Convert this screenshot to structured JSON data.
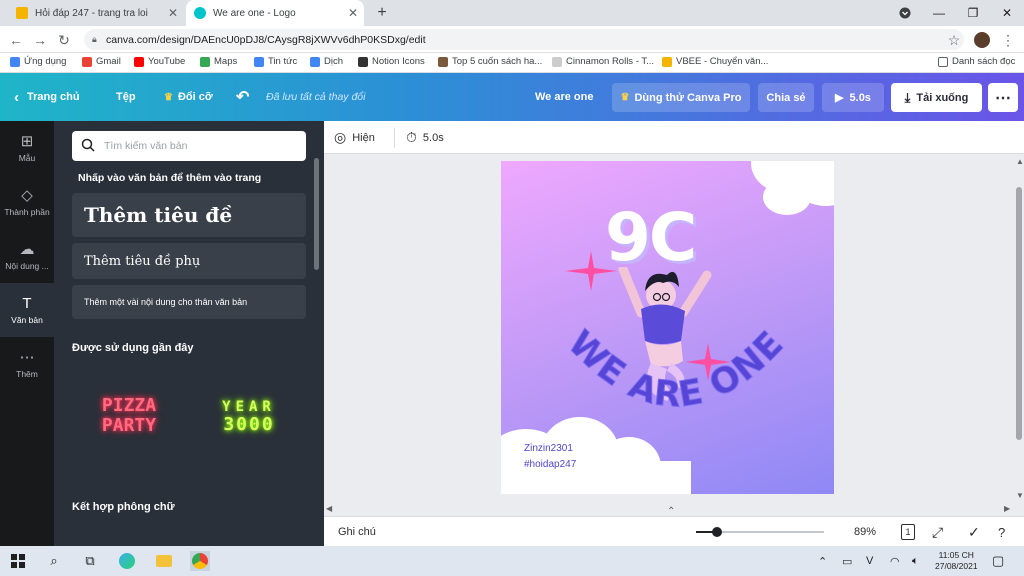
{
  "browser": {
    "tabs": [
      {
        "title": "Hỏi đáp 247 - trang tra loi",
        "active": false,
        "favicon_color": "#f4b400"
      },
      {
        "title": "We are one - Logo",
        "active": true,
        "favicon_color": "#00c4cc"
      }
    ],
    "new_tab_label": "+",
    "url": "canva.com/design/DAEncU0pDJ8/CAysgR8jXWVv6dhP0KSDxg/edit",
    "bookmarks": [
      {
        "label": "Ứng dụng",
        "color": "#4285f4"
      },
      {
        "label": "Gmail",
        "color": "#ea4335"
      },
      {
        "label": "YouTube",
        "color": "#ff0000"
      },
      {
        "label": "Maps",
        "color": "#34a853"
      },
      {
        "label": "Tin tức",
        "color": "#4285f4"
      },
      {
        "label": "Dịch",
        "color": "#4285f4"
      },
      {
        "label": "Notion Icons",
        "color": "#333333"
      },
      {
        "label": "Top 5 cuốn sách ha...",
        "color": "#7a5c3c"
      },
      {
        "label": "Cinnamon Rolls - T...",
        "color": "#cccccc"
      },
      {
        "label": "VBEE - Chuyển văn...",
        "color": "#f4b400"
      }
    ],
    "bookmark_list_label": "Danh sách đọc"
  },
  "canva_header": {
    "home": "Trang chủ",
    "file": "Tệp",
    "resize": "Đổi cỡ",
    "saved_status": "Đã lưu tất cả thay đổi",
    "design_title": "We are one",
    "try_pro": "Dùng thử Canva Pro",
    "share": "Chia sẻ",
    "play_duration": "5.0s",
    "download": "Tải xuống"
  },
  "sidebar": {
    "items": [
      {
        "label": "Mẫu",
        "icon": "template-icon"
      },
      {
        "label": "Thành phần",
        "icon": "elements-icon"
      },
      {
        "label": "Nội dung ...",
        "icon": "upload-icon"
      },
      {
        "label": "Văn bản",
        "icon": "text-icon",
        "active": true
      },
      {
        "label": "Thêm",
        "icon": "more-icon"
      }
    ]
  },
  "text_panel": {
    "search_placeholder": "Tìm kiếm văn bản",
    "hint": "Nhấp vào văn bản để thêm vào trang",
    "heading": "Thêm tiêu đề",
    "subheading": "Thêm tiêu đề phụ",
    "body": "Thêm một vài nội dung cho thân văn bản",
    "recent_title": "Được sử dụng gần đây",
    "recent_fonts": [
      {
        "line1": "PIZZA",
        "line2": "PARTY"
      },
      {
        "line1": "YEAR",
        "line2": "3000"
      }
    ],
    "combos_title": "Kết hợp phông chữ"
  },
  "editor": {
    "animate_label": "Hiện",
    "duration": "5.0s",
    "canvas": {
      "title": "9C",
      "arc_text": "WE ARE ONE",
      "handle1": "Zinzin2301",
      "handle2": "#hoidap247"
    },
    "notes_label": "Ghi chú",
    "zoom": "89%",
    "page_count": "1"
  },
  "taskbar": {
    "time": "11:05 CH",
    "date": "27/08/2021"
  }
}
